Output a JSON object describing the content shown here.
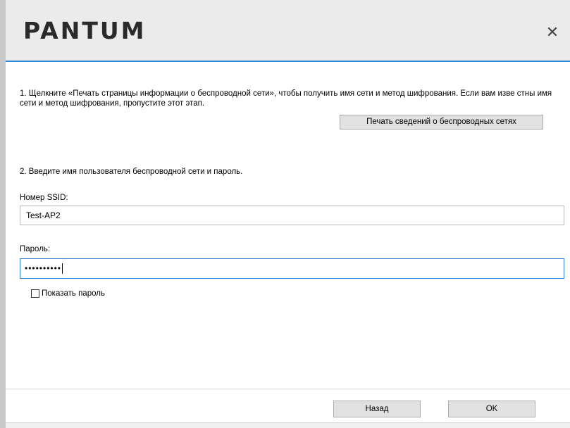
{
  "header": {
    "logo_text": "PANTUM",
    "close_glyph": "✕"
  },
  "step1": {
    "text": "1. Щелкните «Печать страницы информации о беспроводной сети», чтобы получить имя сети и метод шифрования. Если вам изве стны имя сети и метод шифрования, пропустите этот этап.",
    "print_button_label": "Печать сведений о беспроводных сетях"
  },
  "step2": {
    "text": "2. Введите имя пользователя беспроводной сети и пароль.",
    "ssid_label": "Номер SSID:",
    "ssid_value": "Test-AP2",
    "password_label": "Пароль:",
    "password_value": "••••••••••",
    "show_password_label": "Показать пароль",
    "show_password_checked": false
  },
  "footer": {
    "back_label": "Назад",
    "ok_label": "OK"
  },
  "colors": {
    "accent": "#2e89d6",
    "header_bg": "#ebebeb",
    "button_bg": "#e1e1e1"
  }
}
